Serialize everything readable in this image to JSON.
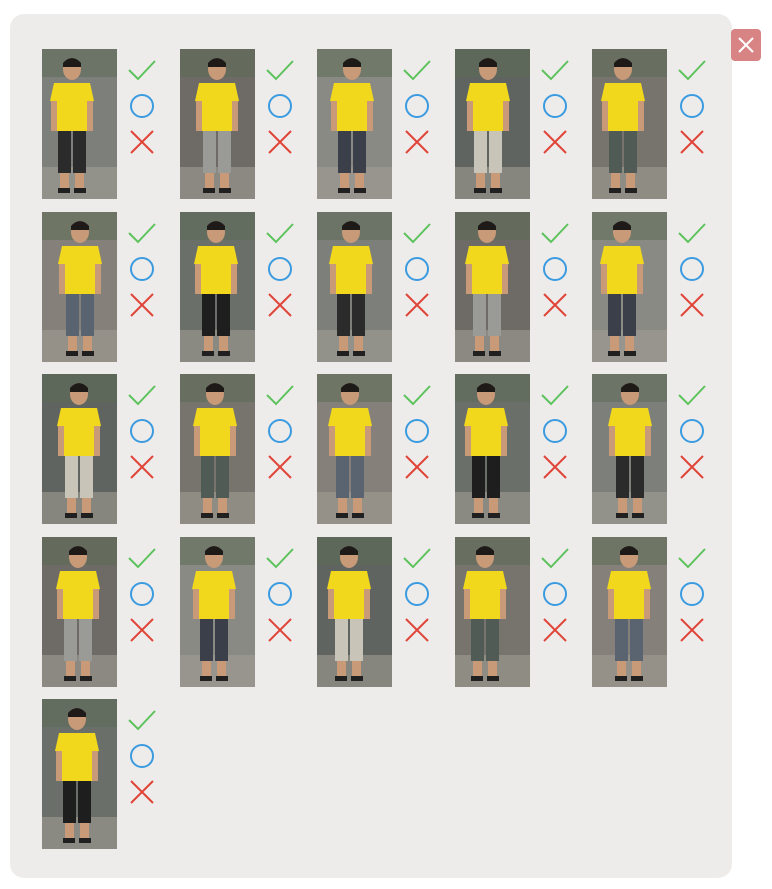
{
  "window": {
    "close_icon": "close-icon",
    "close_color": "#d98484"
  },
  "marks": {
    "accept": {
      "icon": "checkmark-icon",
      "color": "#5cc35c"
    },
    "unsure": {
      "icon": "circle-icon",
      "color": "#3b9be0"
    },
    "reject": {
      "icon": "cross-icon",
      "color": "#e0453a"
    }
  },
  "images": [
    {
      "id": 1
    },
    {
      "id": 2
    },
    {
      "id": 3
    },
    {
      "id": 4
    },
    {
      "id": 5
    },
    {
      "id": 6
    },
    {
      "id": 7
    },
    {
      "id": 8
    },
    {
      "id": 9
    },
    {
      "id": 10
    },
    {
      "id": 11
    },
    {
      "id": 12
    },
    {
      "id": 13
    },
    {
      "id": 14
    },
    {
      "id": 15
    },
    {
      "id": 16
    },
    {
      "id": 17
    },
    {
      "id": 18
    },
    {
      "id": 19
    },
    {
      "id": 20
    },
    {
      "id": 21
    }
  ],
  "colors": {
    "shirt": "#f2d81c",
    "panel": "#eeecea"
  }
}
